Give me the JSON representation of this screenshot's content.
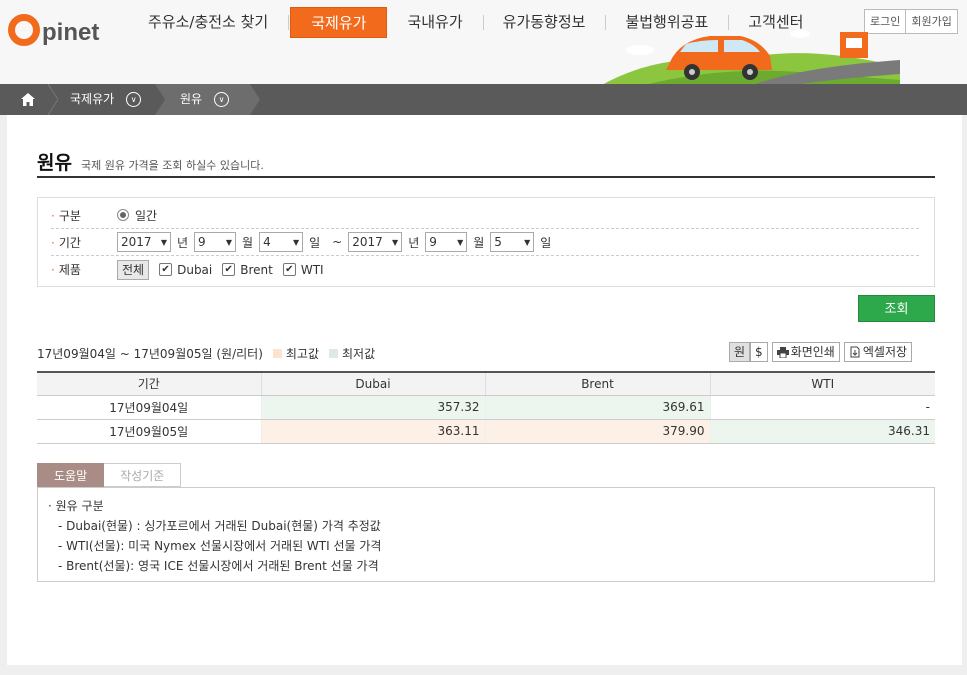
{
  "logo": {
    "text": "pinet",
    "color": "#f26b1d"
  },
  "nav": {
    "items": [
      {
        "label": "주유소/충전소 찾기",
        "active": false
      },
      {
        "label": "국제유가",
        "active": true
      },
      {
        "label": "국내유가",
        "active": false
      },
      {
        "label": "유가동향정보",
        "active": false
      },
      {
        "label": "불법행위공표",
        "active": false
      },
      {
        "label": "고객센터",
        "active": false
      }
    ]
  },
  "auth": {
    "login": "로그인",
    "join": "회원가입"
  },
  "breadcrumb": {
    "home_icon": "home-icon",
    "level1": "국제유가",
    "level2": "원유"
  },
  "page": {
    "title": "원유",
    "description": "국제 원유 가격을 조회 하실수 있습니다."
  },
  "search": {
    "type_label": "구분",
    "type_option": "일간",
    "period_label": "기간",
    "start": {
      "year": "2017",
      "month": "9",
      "day": "4"
    },
    "end": {
      "year": "2017",
      "month": "9",
      "day": "5"
    },
    "unit_year": "년",
    "unit_month": "월",
    "unit_day": "일",
    "tilde": "~",
    "product_label": "제품",
    "all_button": "전체",
    "products": [
      "Dubai",
      "Brent",
      "WTI"
    ],
    "query_button": "조회"
  },
  "result": {
    "range_text": "17년09월04일 ~ 17년09월05일 (원/리터)",
    "legend_high": "최고값",
    "legend_low": "최저값",
    "high_color": "#fdf0e6",
    "low_color": "#edf5ef",
    "currency_won": "원",
    "currency_usd": "$",
    "print_button": "화면인쇄",
    "excel_button": "엑셀저장"
  },
  "table": {
    "headers": [
      "기간",
      "Dubai",
      "Brent",
      "WTI"
    ],
    "rows": [
      {
        "date": "17년09월04일",
        "dubai": "357.32",
        "brent": "369.61",
        "wti": "-"
      },
      {
        "date": "17년09월05일",
        "dubai": "363.11",
        "brent": "379.90",
        "wti": "346.31"
      }
    ]
  },
  "help": {
    "tab_help": "도움말",
    "tab_criteria": "작성기준",
    "heading": "· 원유 구분",
    "lines": [
      "- Dubai(현물) : 싱가포르에서 거래된 Dubai(현물) 가격 추정값",
      "- WTI(선물): 미국 Nymex 선물시장에서 거래된 WTI 선물 가격",
      "- Brent(선물): 영국 ICE 선물시장에서 거래된 Brent 선물 가격"
    ]
  }
}
